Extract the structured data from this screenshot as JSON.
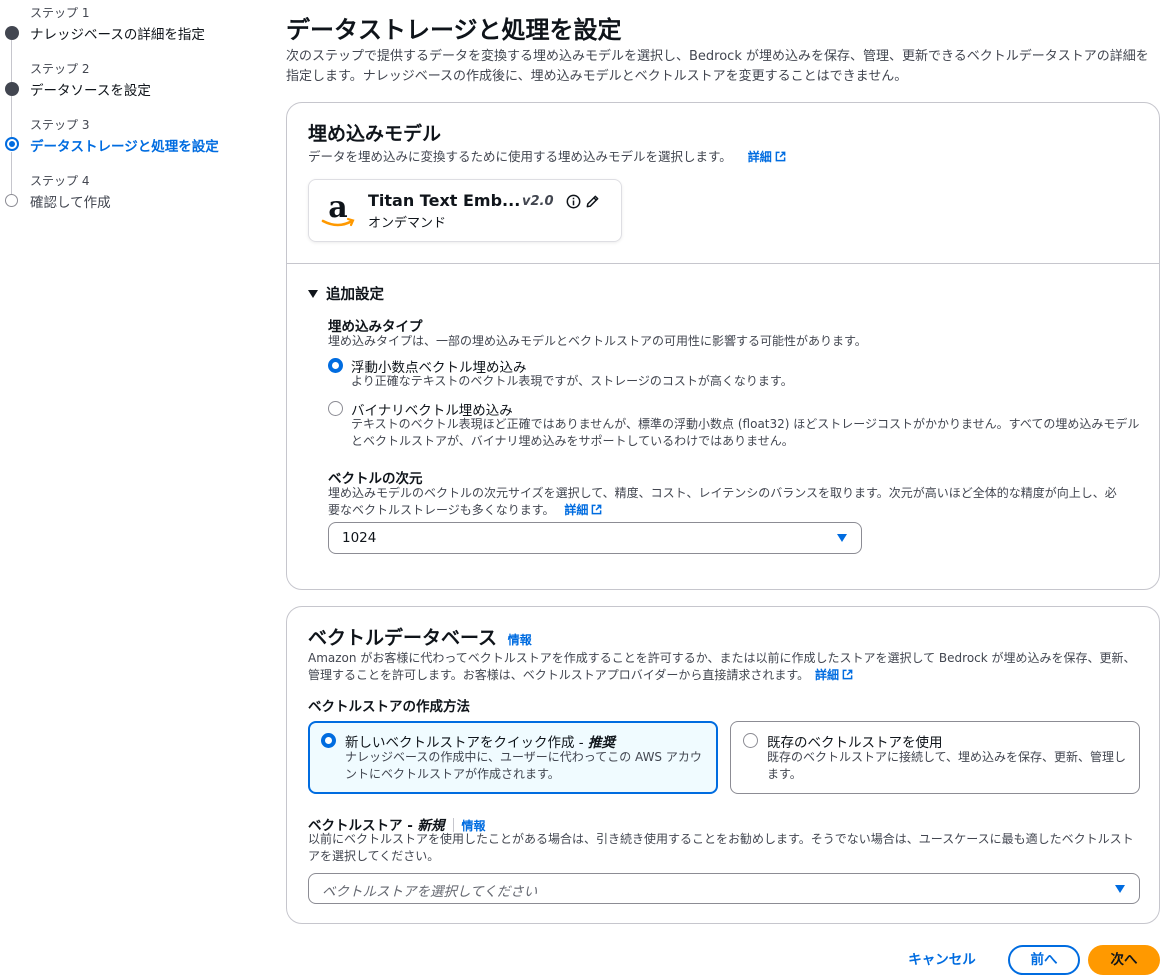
{
  "steps": [
    {
      "num": "ステップ 1",
      "title": "ナレッジベースの詳細を指定",
      "state": "done"
    },
    {
      "num": "ステップ 2",
      "title": "データソースを設定",
      "state": "done"
    },
    {
      "num": "ステップ 3",
      "title": "データストレージと処理を設定",
      "state": "active"
    },
    {
      "num": "ステップ 4",
      "title": "確認して作成",
      "state": "pending"
    }
  ],
  "page": {
    "title": "データストレージと処理を設定",
    "description": "次のステップで提供するデータを変換する埋め込みモデルを選択し、Bedrock が埋め込みを保存、管理、更新できるベクトルデータストアの詳細を指定します。ナレッジベースの作成後に、埋め込みモデルとベクトルストアを変更することはできません。"
  },
  "embedding": {
    "title": "埋め込みモデル",
    "description": "データを埋め込みに変換するために使用する埋め込みモデルを選択します。",
    "learn_more": "詳細",
    "model": {
      "name": "Titan Text Emb...",
      "version": "v2.0",
      "subtitle": "オンデマンド",
      "logo_icon": "amazon-logo-icon"
    },
    "additional": {
      "label": "追加設定",
      "type_label": "埋め込みタイプ",
      "type_desc": "埋め込みタイプは、一部の埋め込みモデルとベクトルストアの可用性に影響する可能性があります。",
      "options": [
        {
          "label": "浮動小数点ベクトル埋め込み",
          "desc": "より正確なテキストのベクトル表現ですが、ストレージのコストが高くなります。",
          "selected": true
        },
        {
          "label": "バイナリベクトル埋め込み",
          "desc": "テキストのベクトル表現ほど正確ではありませんが、標準の浮動小数点 (float32) ほどストレージコストがかかりません。すべての埋め込みモデルとベクトルストアが、バイナリ埋め込みをサポートしているわけではありません。",
          "selected": false
        }
      ],
      "dim_label": "ベクトルの次元",
      "dim_desc": "埋め込みモデルのベクトルの次元サイズを選択して、精度、コスト、レイテンシのバランスを取ります。次元が高いほど全体的な精度が向上し、必要なベクトルストレージも多くなります。",
      "dim_learn_more": "詳細",
      "dim_value": "1024"
    }
  },
  "vector_db": {
    "title": "ベクトルデータベース",
    "info": "情報",
    "description": "Amazon がお客様に代わってベクトルストアを作成することを許可するか、または以前に作成したストアを選択して Bedrock が埋め込みを保存、更新、管理することを許可します。お客様は、ベクトルストアプロバイダーから直接請求されます。",
    "learn_more": "詳細",
    "method_label": "ベクトルストアの作成方法",
    "methods": [
      {
        "label": "新しいベクトルストアをクイック作成 - ",
        "label_em": "推奨",
        "desc": "ナレッジベースの作成中に、ユーザーに代わってこの AWS アカウントにベクトルストアが作成されます。",
        "selected": true
      },
      {
        "label": "既存のベクトルストアを使用",
        "label_em": "",
        "desc": "既存のベクトルストアに接続して、埋め込みを保存、更新、管理します。",
        "selected": false
      }
    ],
    "store_label": "ベクトルストア - ",
    "store_label_em": "新規",
    "store_info": "情報",
    "store_desc": "以前にベクトルストアを使用したことがある場合は、引き続き使用することをお勧めします。そうでない場合は、ユースケースに最も適したベクトルストアを選択してください。",
    "store_placeholder": "ベクトルストアを選択してください"
  },
  "footer": {
    "cancel": "キャンセル",
    "prev": "前へ",
    "next": "次へ"
  },
  "colors": {
    "accent": "#006ce0",
    "primary_button": "#ff9900"
  }
}
